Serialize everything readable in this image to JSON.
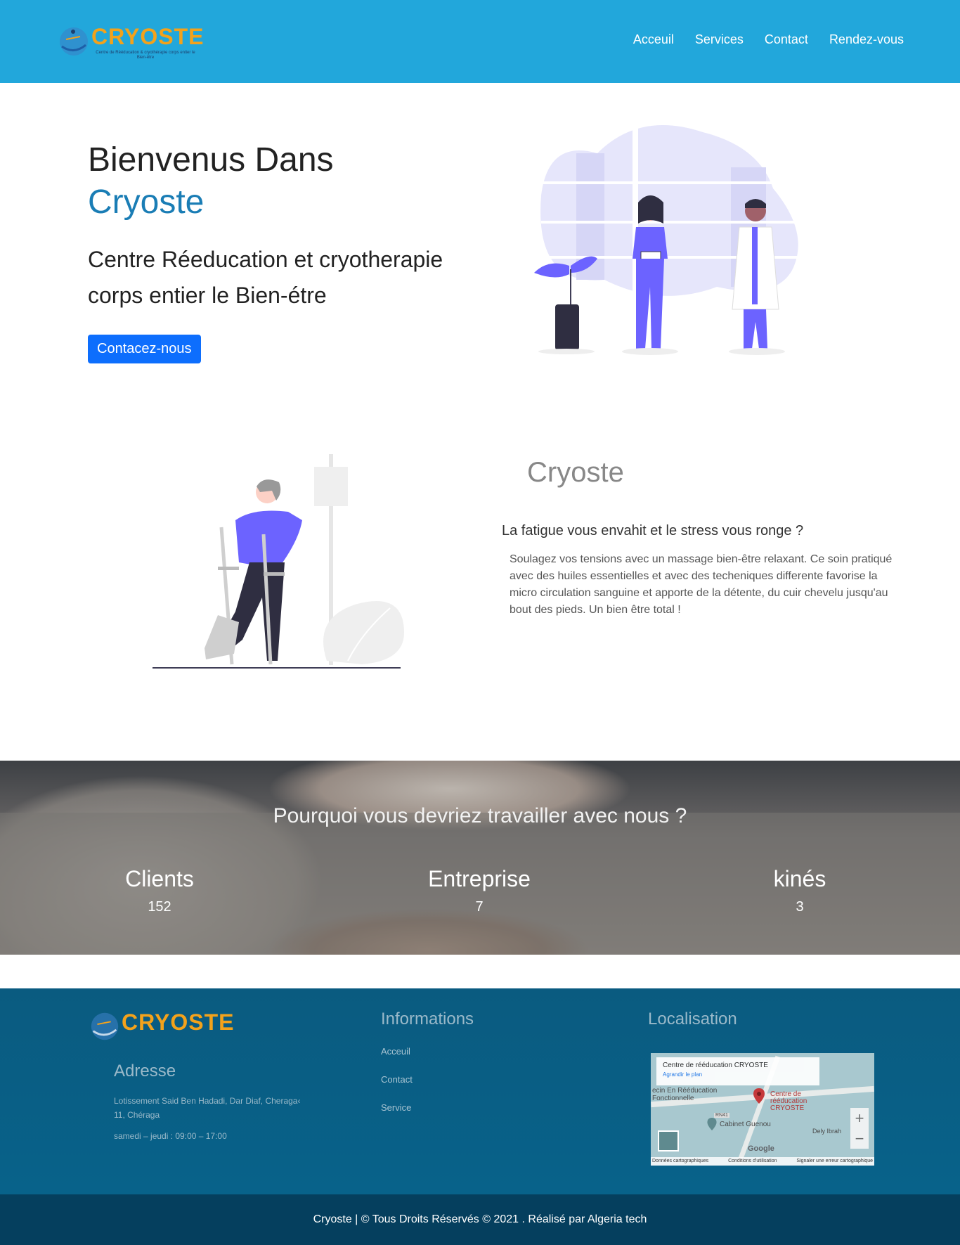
{
  "brand": {
    "name": "CRYOSTE",
    "tagline": "Centre de Rééducation & cryothérapie corps entier le Bien-être"
  },
  "nav": [
    "Acceuil",
    "Services",
    "Contact",
    "Rendez-vous"
  ],
  "hero": {
    "title_line1": "Bienvenus Dans",
    "title_line2": "Cryoste",
    "subtitle": "Centre Réeducation et cryotherapie corps entier le Bien-étre",
    "cta": "Contacez-nous"
  },
  "about": {
    "title": "Cryoste",
    "question": "La fatigue vous envahit et le stress vous ronge ?",
    "text": "Soulagez vos tensions avec un massage bien-être relaxant. Ce soin pratiqué avec des huiles essentielles et avec des techeniques differente favorise la micro circulation sanguine et apporte de la détente, du cuir chevelu jusqu'au bout des pieds. Un bien être total !"
  },
  "stats": {
    "title": "Pourquoi vous devriez travailler avec nous ?",
    "items": [
      {
        "label": "Clients",
        "value": "152"
      },
      {
        "label": "Entreprise",
        "value": "7"
      },
      {
        "label": "kinés",
        "value": "3"
      }
    ]
  },
  "footer": {
    "address_heading": "Adresse",
    "address": "Lotissement Said Ben Hadadi, Dar Diaf, Cheraga‹ 11, Chéraga",
    "hours": "samedi – jeudi : 09:00 – 17:00",
    "info_heading": "Informations",
    "info_links": [
      "Acceuil",
      "Contact",
      "Service"
    ],
    "loc_heading": "Localisation",
    "map": {
      "place": "Centre de rééducation CRYOSTE",
      "enlarge": "Agrandir le plan",
      "label_center": "ecin En Rééducation Fonctionnelle",
      "label_pin": "Centre de rééducation CRYOSTE",
      "label_cabinet": "Cabinet Guenou",
      "label_right": "Dely Ibrah",
      "road": "RN41",
      "google": "Google",
      "attrib": [
        "Données cartographiques",
        "Conditions d'utilisation",
        "Signaler une erreur cartographique"
      ]
    }
  },
  "copyright": "Cryoste | © Tous Droits Réservés © 2021 . Réalisé par Algeria tech",
  "colors": {
    "header": "#22a7db",
    "accent_blue": "#1a7db5",
    "cta": "#0d6efd",
    "logo_orange": "#f3a21b",
    "footer": "#0a5b80",
    "copyright": "#053f5e"
  }
}
